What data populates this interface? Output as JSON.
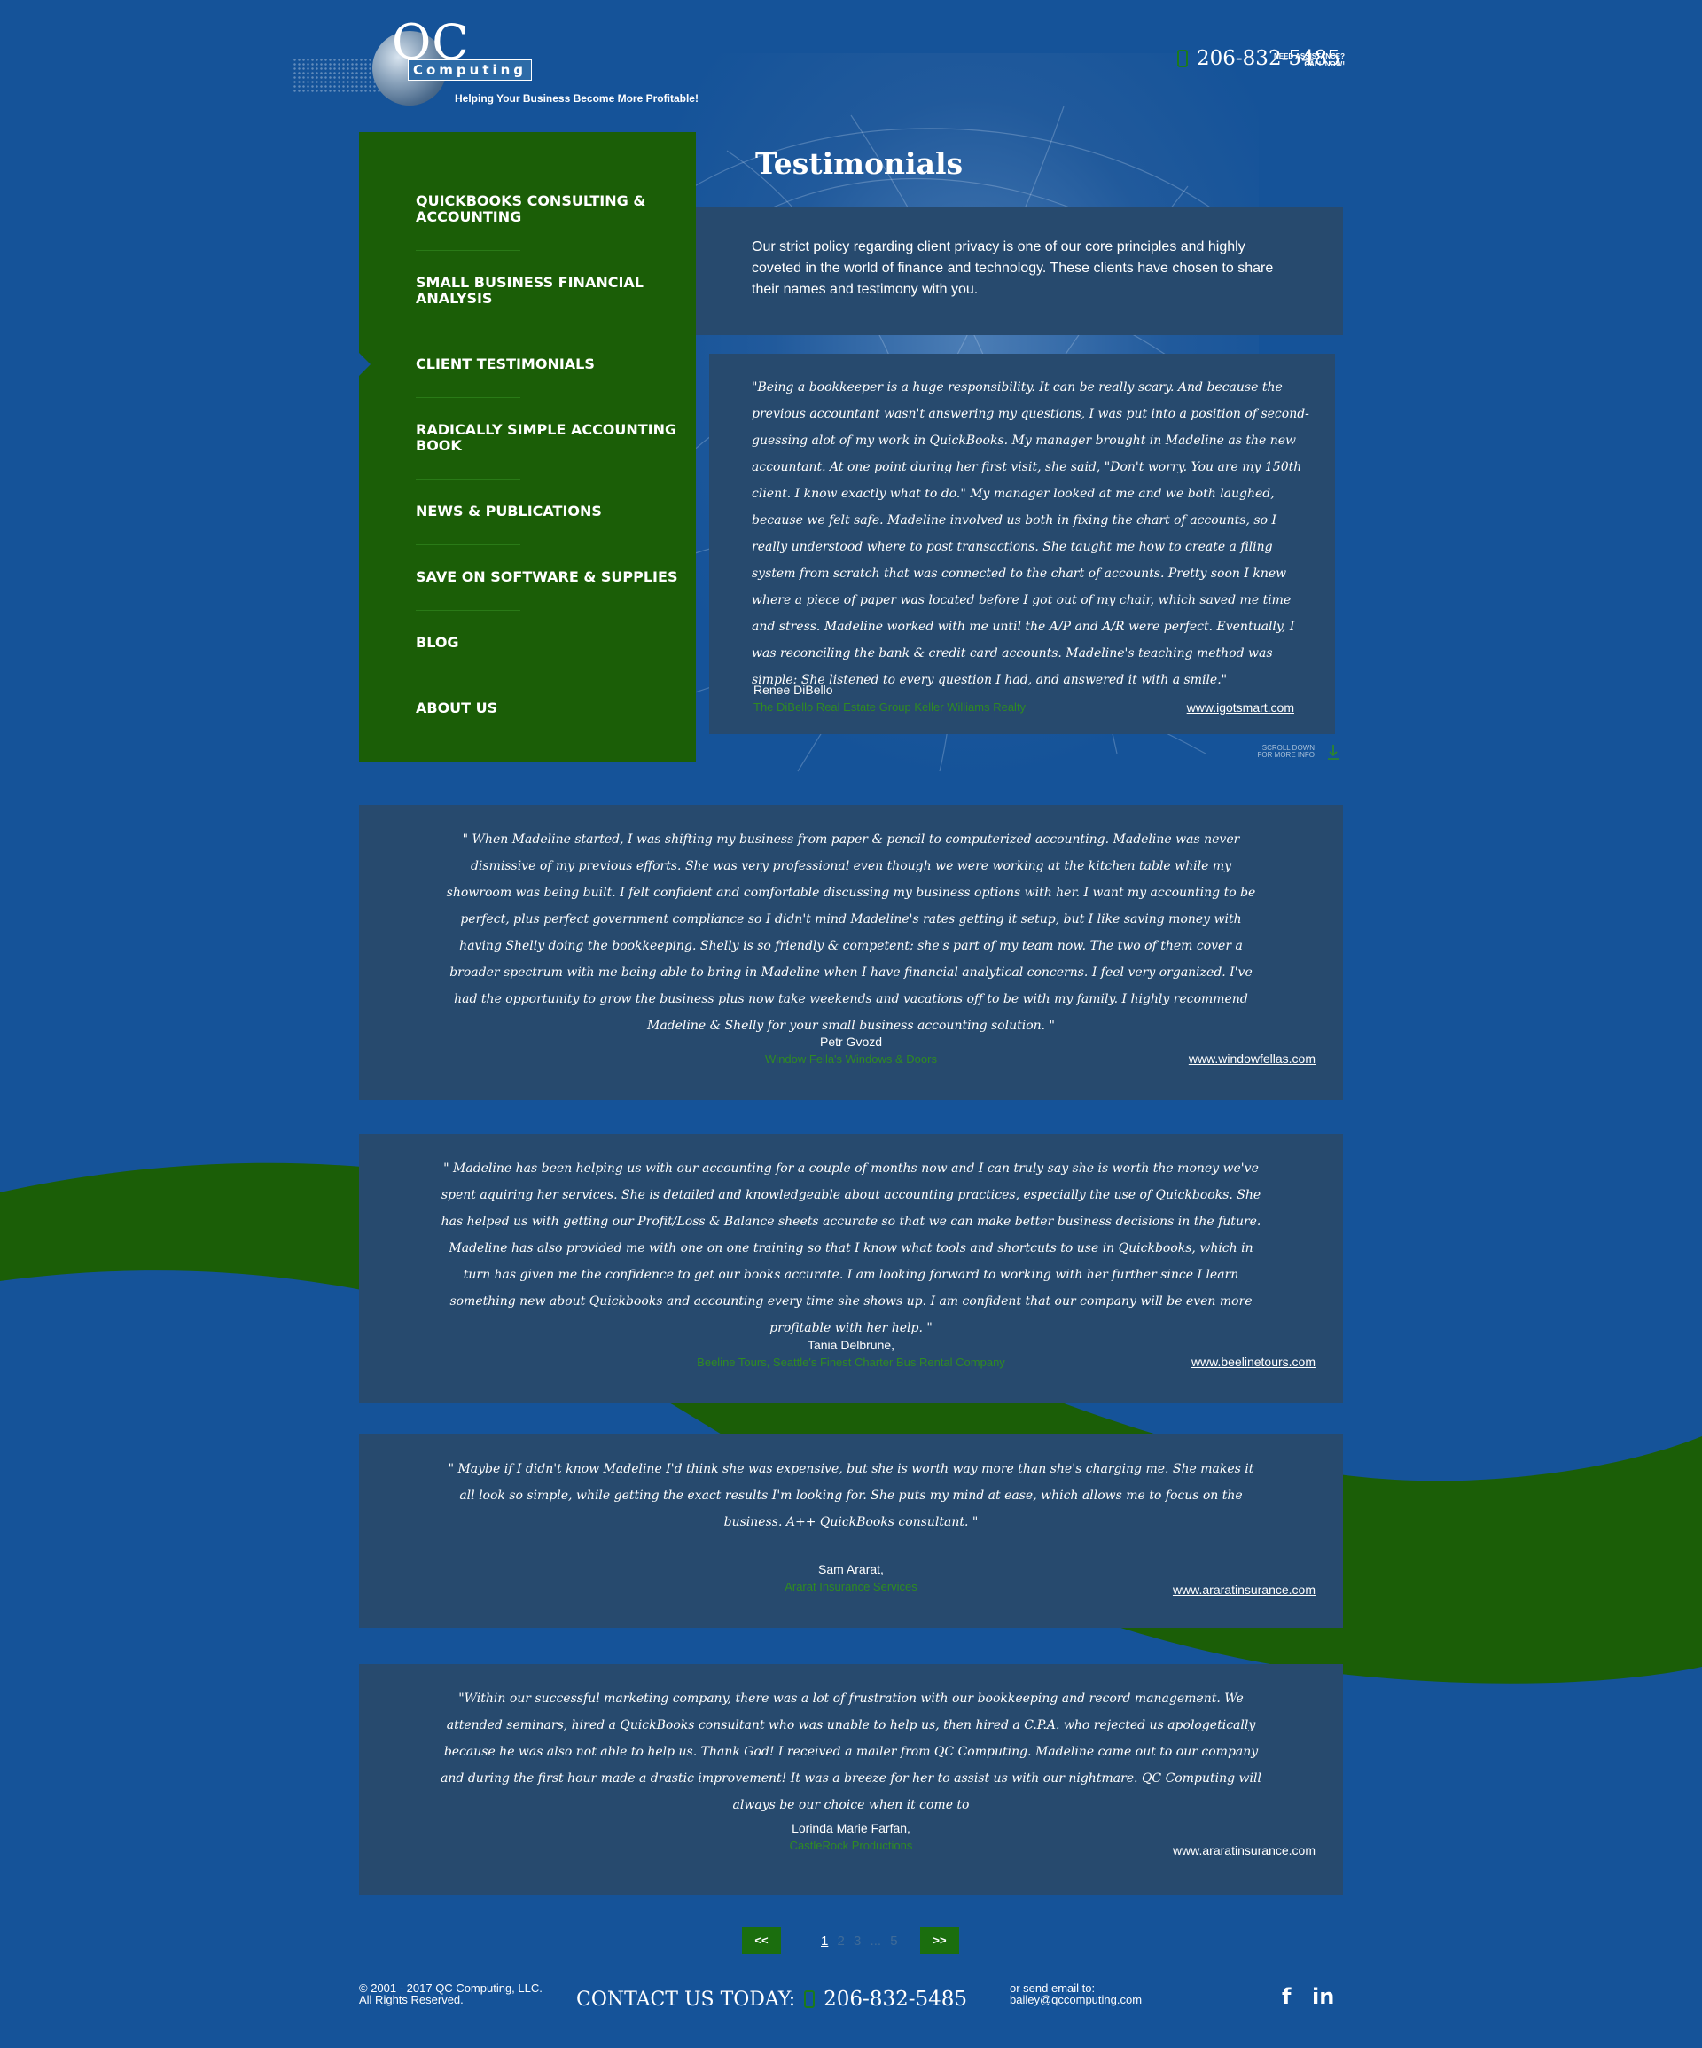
{
  "brand": {
    "logo_letters": "QC",
    "logo_word": "Computing",
    "tagline": "Helping Your Business Become More Profitable!"
  },
  "header": {
    "assist_line1": "NEED ASSISTANCE?",
    "assist_line2": "CALL NOW!",
    "phone": "206-832-5485"
  },
  "page": {
    "title": "Testimonials"
  },
  "sidebar": {
    "items": [
      {
        "label": "QUICKBOOKS CONSULTING & ACCOUNTING"
      },
      {
        "label": "SMALL BUSINESS FINANCIAL ANALYSIS"
      },
      {
        "label": "CLIENT TESTIMONIALS"
      },
      {
        "label": "RADICALLY SIMPLE ACCOUNTING BOOK"
      },
      {
        "label": "NEWS & PUBLICATIONS"
      },
      {
        "label": "SAVE ON SOFTWARE & SUPPLIES"
      },
      {
        "label": "BLOG"
      },
      {
        "label": "ABOUT US"
      }
    ],
    "active_index": 2
  },
  "intro": {
    "text": "Our strict policy regarding client privacy is one of our core principles and highly coveted in the world of finance and technology. These clients have chosen to share their names and testimony with you."
  },
  "scroll_hint": {
    "line1": "SCROLL DOWN",
    "line2": "FOR MORE INFO"
  },
  "testimonials": [
    {
      "quote": "\"Being a bookkeeper is a huge responsibility. It can be really scary. And because the previous accountant wasn't answering my questions, I was put into a position of second-guessing alot of my work in QuickBooks. My manager brought in Madeline as the new accountant. At one point during her first visit, she said, \"Don't worry. You are my 150th client. I know exactly what to do.\" My manager looked at me and we both laughed, because we felt safe. Madeline involved us both in fixing the chart of accounts, so I really understood where to post transactions. She taught me how to create a filing system from scratch that was connected to the chart of accounts. Pretty soon I knew where a piece of paper was located before I got out of my chair, which saved me time and stress. Madeline worked with me until the A/P and A/R were perfect. Eventually, I was reconciling the bank & credit card accounts. Madeline's teaching method was simple: She listened to every question I had, and answered it with a smile.\"",
      "author": "Renee DiBello",
      "company": "The DiBello Real Estate Group Keller Williams Realty",
      "site": "www.igotsmart.com"
    },
    {
      "quote": "\" When Madeline started, I was shifting my business from paper & pencil to computerized accounting. Madeline was never dismissive of my previous efforts. She was very professional even though we were working at the kitchen table while my showroom was being built. I felt confident and comfortable discussing my business options with her. I want my accounting to be perfect, plus perfect government compliance so I didn't mind Madeline's rates getting it setup, but I like saving money with having Shelly doing the bookkeeping. Shelly is so friendly & competent; she's part of my team now. The two of them cover a broader spectrum with me being able to bring in Madeline when I have financial analytical concerns. I feel very organized. I've had the opportunity to grow the business plus now take weekends and vacations off to be with my family. I highly recommend Madeline & Shelly for your small business accounting solution. \"",
      "author": "Petr Gvozd",
      "company": "Window Fella's Windows & Doors",
      "site": "www.windowfellas.com"
    },
    {
      "quote": "\" Madeline has been helping us with our accounting for a couple of months now and I can truly say she is worth the money we've spent aquiring her services. She is detailed and knowledgeable about accounting practices, especially the use of Quickbooks. She has helped us with getting our Profit/Loss & Balance sheets accurate so that we can make better business decisions in the future. Madeline has also provided me with one on one training so that I know what tools and shortcuts to use in Quickbooks, which in turn has given me the confidence to get our books accurate. I am looking forward to working with her further since I learn something new about Quickbooks and accounting every time she shows up. I am confident that our company will be even more profitable with her help. \"",
      "author": "Tania Delbrune,",
      "company": "Beeline Tours, Seattle's Finest Charter Bus Rental Company",
      "site": "www.beelinetours.com"
    },
    {
      "quote": "\" Maybe if I didn't know Madeline I'd think she was expensive, but she is worth way more than she's charging me. She makes it all look so simple, while getting the exact results I'm looking for. She puts my mind at ease, which allows me to focus on the business. A++ QuickBooks consultant. \"",
      "author": "Sam Ararat,",
      "company": "Ararat Insurance Services",
      "site": "www.araratinsurance.com"
    },
    {
      "quote": "\"Within our successful marketing company, there was a lot of frustration with our bookkeeping and record management. We attended seminars, hired a QuickBooks consultant who was unable to help us, then hired a C.P.A. who rejected us apologetically because he was also not able to help us. Thank God! I received a mailer from QC Computing. Madeline came out to our company and during the first hour made a drastic improvement! It was a breeze for her to assist us with our nightmare. QC Computing will always be our choice when it come to",
      "author": "Lorinda Marie Farfan,",
      "company": "CastleRock Productions",
      "site": "www.araratinsurance.com"
    }
  ],
  "pagination": {
    "prev": "<<",
    "next": ">>",
    "pages": [
      "1",
      "2",
      "3",
      "...",
      "5"
    ],
    "current": "1"
  },
  "footer": {
    "copyright_line1": "© 2001 - 2017 QC Computing, LLC.",
    "copyright_line2": "All Rights Reserved.",
    "contact_label": "CONTACT US TODAY:",
    "phone": "206-832-5485",
    "email_label": "or send email to:",
    "email": "bailey@qccomputing.com",
    "social": [
      "f",
      "in"
    ]
  },
  "colors": {
    "background": "#155399",
    "sidebar": "#1b5e07",
    "card": "#274a6e",
    "accent_green": "#2f8a22"
  }
}
